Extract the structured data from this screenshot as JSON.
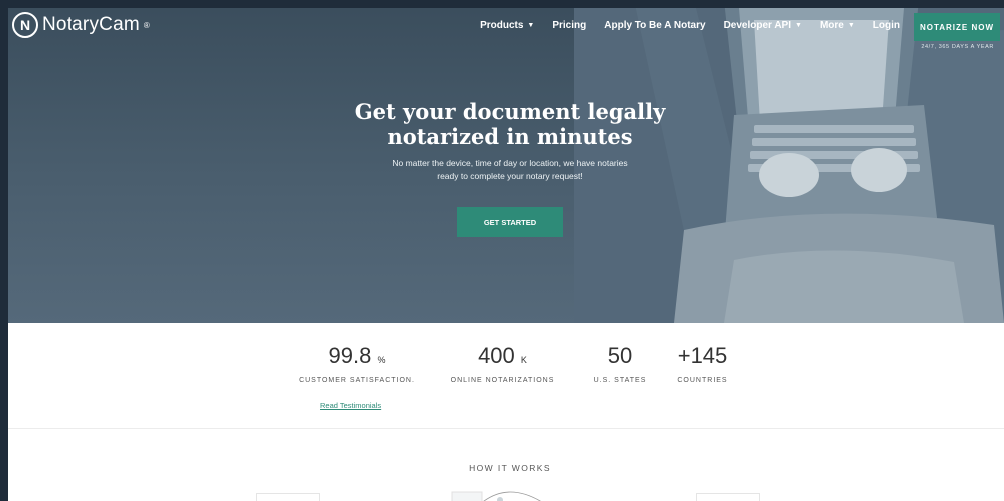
{
  "brand": {
    "name": "NotaryCam",
    "reg": "®",
    "mark": "N"
  },
  "nav": {
    "items": [
      {
        "label": "Products",
        "caret": true
      },
      {
        "label": "Pricing",
        "caret": false
      },
      {
        "label": "Apply To Be A Notary",
        "caret": false
      },
      {
        "label": "Developer API",
        "caret": true
      },
      {
        "label": "More",
        "caret": true
      },
      {
        "label": "Login",
        "caret": false
      }
    ],
    "cta_label": "NOTARIZE NOW",
    "cta_sub": "24/7, 365 DAYS A YEAR"
  },
  "hero": {
    "title_line1": "Get your document legally",
    "title_line2": "notarized in minutes",
    "subtitle_line1": "No matter the device, time of day or location, we have notaries",
    "subtitle_line2": "ready to complete your notary request!",
    "button_label": "GET STARTED"
  },
  "stats": {
    "items": [
      {
        "value": "99.8",
        "unit": "%",
        "label": "CUSTOMER SATISFACTION."
      },
      {
        "value": "400",
        "unit": "K",
        "label": "ONLINE NOTARIZATIONS"
      },
      {
        "value": "50",
        "unit": "",
        "label": "U.S. STATES"
      },
      {
        "value": "+145",
        "unit": "",
        "label": "COUNTRIES"
      }
    ],
    "link_label": "Read Testimonials"
  },
  "how": {
    "label": "HOW IT WORKS"
  },
  "colors": {
    "accent": "#2e8b78",
    "hero_bg": "#4a5e6e"
  }
}
